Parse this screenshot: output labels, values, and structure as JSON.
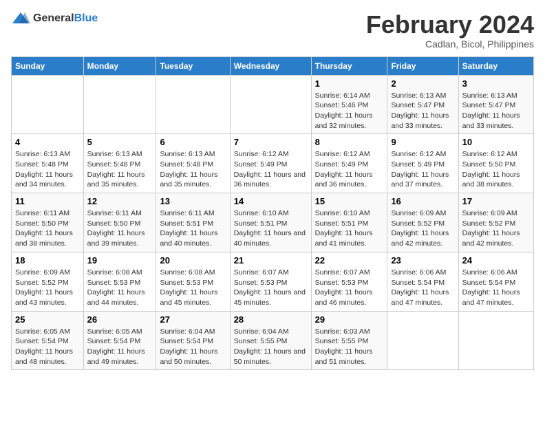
{
  "logo": {
    "general": "General",
    "blue": "Blue"
  },
  "title": "February 2024",
  "subtitle": "Cadlan, Bicol, Philippines",
  "headers": [
    "Sunday",
    "Monday",
    "Tuesday",
    "Wednesday",
    "Thursday",
    "Friday",
    "Saturday"
  ],
  "weeks": [
    [
      {
        "day": "",
        "sunrise": "",
        "sunset": "",
        "daylight": ""
      },
      {
        "day": "",
        "sunrise": "",
        "sunset": "",
        "daylight": ""
      },
      {
        "day": "",
        "sunrise": "",
        "sunset": "",
        "daylight": ""
      },
      {
        "day": "",
        "sunrise": "",
        "sunset": "",
        "daylight": ""
      },
      {
        "day": "1",
        "sunrise": "Sunrise: 6:14 AM",
        "sunset": "Sunset: 5:46 PM",
        "daylight": "Daylight: 11 hours and 32 minutes."
      },
      {
        "day": "2",
        "sunrise": "Sunrise: 6:13 AM",
        "sunset": "Sunset: 5:47 PM",
        "daylight": "Daylight: 11 hours and 33 minutes."
      },
      {
        "day": "3",
        "sunrise": "Sunrise: 6:13 AM",
        "sunset": "Sunset: 5:47 PM",
        "daylight": "Daylight: 11 hours and 33 minutes."
      }
    ],
    [
      {
        "day": "4",
        "sunrise": "Sunrise: 6:13 AM",
        "sunset": "Sunset: 5:48 PM",
        "daylight": "Daylight: 11 hours and 34 minutes."
      },
      {
        "day": "5",
        "sunrise": "Sunrise: 6:13 AM",
        "sunset": "Sunset: 5:48 PM",
        "daylight": "Daylight: 11 hours and 35 minutes."
      },
      {
        "day": "6",
        "sunrise": "Sunrise: 6:13 AM",
        "sunset": "Sunset: 5:48 PM",
        "daylight": "Daylight: 11 hours and 35 minutes."
      },
      {
        "day": "7",
        "sunrise": "Sunrise: 6:12 AM",
        "sunset": "Sunset: 5:49 PM",
        "daylight": "Daylight: 11 hours and 36 minutes."
      },
      {
        "day": "8",
        "sunrise": "Sunrise: 6:12 AM",
        "sunset": "Sunset: 5:49 PM",
        "daylight": "Daylight: 11 hours and 36 minutes."
      },
      {
        "day": "9",
        "sunrise": "Sunrise: 6:12 AM",
        "sunset": "Sunset: 5:49 PM",
        "daylight": "Daylight: 11 hours and 37 minutes."
      },
      {
        "day": "10",
        "sunrise": "Sunrise: 6:12 AM",
        "sunset": "Sunset: 5:50 PM",
        "daylight": "Daylight: 11 hours and 38 minutes."
      }
    ],
    [
      {
        "day": "11",
        "sunrise": "Sunrise: 6:11 AM",
        "sunset": "Sunset: 5:50 PM",
        "daylight": "Daylight: 11 hours and 38 minutes."
      },
      {
        "day": "12",
        "sunrise": "Sunrise: 6:11 AM",
        "sunset": "Sunset: 5:50 PM",
        "daylight": "Daylight: 11 hours and 39 minutes."
      },
      {
        "day": "13",
        "sunrise": "Sunrise: 6:11 AM",
        "sunset": "Sunset: 5:51 PM",
        "daylight": "Daylight: 11 hours and 40 minutes."
      },
      {
        "day": "14",
        "sunrise": "Sunrise: 6:10 AM",
        "sunset": "Sunset: 5:51 PM",
        "daylight": "Daylight: 11 hours and 40 minutes."
      },
      {
        "day": "15",
        "sunrise": "Sunrise: 6:10 AM",
        "sunset": "Sunset: 5:51 PM",
        "daylight": "Daylight: 11 hours and 41 minutes."
      },
      {
        "day": "16",
        "sunrise": "Sunrise: 6:09 AM",
        "sunset": "Sunset: 5:52 PM",
        "daylight": "Daylight: 11 hours and 42 minutes."
      },
      {
        "day": "17",
        "sunrise": "Sunrise: 6:09 AM",
        "sunset": "Sunset: 5:52 PM",
        "daylight": "Daylight: 11 hours and 42 minutes."
      }
    ],
    [
      {
        "day": "18",
        "sunrise": "Sunrise: 6:09 AM",
        "sunset": "Sunset: 5:52 PM",
        "daylight": "Daylight: 11 hours and 43 minutes."
      },
      {
        "day": "19",
        "sunrise": "Sunrise: 6:08 AM",
        "sunset": "Sunset: 5:53 PM",
        "daylight": "Daylight: 11 hours and 44 minutes."
      },
      {
        "day": "20",
        "sunrise": "Sunrise: 6:08 AM",
        "sunset": "Sunset: 5:53 PM",
        "daylight": "Daylight: 11 hours and 45 minutes."
      },
      {
        "day": "21",
        "sunrise": "Sunrise: 6:07 AM",
        "sunset": "Sunset: 5:53 PM",
        "daylight": "Daylight: 11 hours and 45 minutes."
      },
      {
        "day": "22",
        "sunrise": "Sunrise: 6:07 AM",
        "sunset": "Sunset: 5:53 PM",
        "daylight": "Daylight: 11 hours and 46 minutes."
      },
      {
        "day": "23",
        "sunrise": "Sunrise: 6:06 AM",
        "sunset": "Sunset: 5:54 PM",
        "daylight": "Daylight: 11 hours and 47 minutes."
      },
      {
        "day": "24",
        "sunrise": "Sunrise: 6:06 AM",
        "sunset": "Sunset: 5:54 PM",
        "daylight": "Daylight: 11 hours and 47 minutes."
      }
    ],
    [
      {
        "day": "25",
        "sunrise": "Sunrise: 6:05 AM",
        "sunset": "Sunset: 5:54 PM",
        "daylight": "Daylight: 11 hours and 48 minutes."
      },
      {
        "day": "26",
        "sunrise": "Sunrise: 6:05 AM",
        "sunset": "Sunset: 5:54 PM",
        "daylight": "Daylight: 11 hours and 49 minutes."
      },
      {
        "day": "27",
        "sunrise": "Sunrise: 6:04 AM",
        "sunset": "Sunset: 5:54 PM",
        "daylight": "Daylight: 11 hours and 50 minutes."
      },
      {
        "day": "28",
        "sunrise": "Sunrise: 6:04 AM",
        "sunset": "Sunset: 5:55 PM",
        "daylight": "Daylight: 11 hours and 50 minutes."
      },
      {
        "day": "29",
        "sunrise": "Sunrise: 6:03 AM",
        "sunset": "Sunset: 5:55 PM",
        "daylight": "Daylight: 11 hours and 51 minutes."
      },
      {
        "day": "",
        "sunrise": "",
        "sunset": "",
        "daylight": ""
      },
      {
        "day": "",
        "sunrise": "",
        "sunset": "",
        "daylight": ""
      }
    ]
  ]
}
